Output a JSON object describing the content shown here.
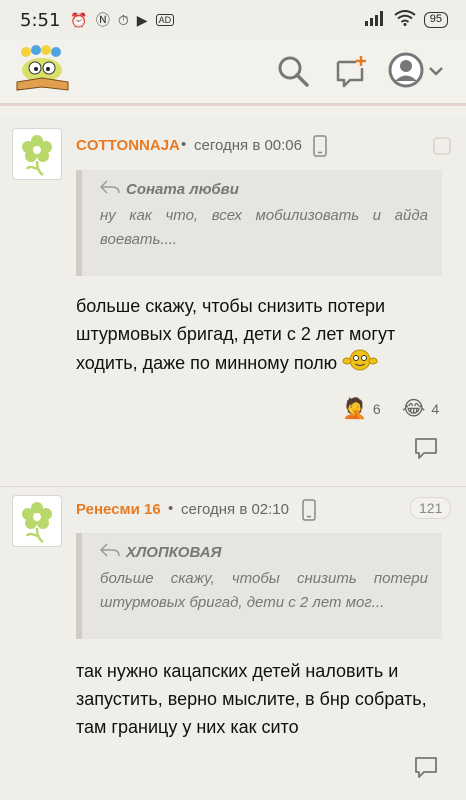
{
  "status": {
    "time": "5:51",
    "battery": "95"
  },
  "comments": [
    {
      "author": "COTTONNAJA",
      "time": "сегодня в 00:06",
      "quote_author": "Соната любви",
      "quote_text": "ну как что, всех мобилизовать и айда воевать....",
      "text": "больше скажу, чтобы снизить потери штурмовых бригад, дети с 2 лет могут ходить, даже по минному полю",
      "reactions": [
        {
          "icon": "facepalm-emoji",
          "count": "6"
        },
        {
          "icon": "laughing-emoji",
          "count": "4"
        }
      ]
    },
    {
      "author": "Ренесми 16",
      "time": "сегодня в 02:10",
      "badge": "121",
      "quote_author": "ХЛОПКОВАЯ",
      "quote_text": "больше скажу, чтобы снизить потери штурмовых бригад, дети с 2 лет мог...",
      "text": "так нужно кацапских детей наловить и запустить, верно мыслите, в бнр собрать, там границу у них как сито"
    }
  ],
  "colors": {
    "author": "#e77a22",
    "background": "#efeee9",
    "quote_bg": "#e6e5e0"
  }
}
